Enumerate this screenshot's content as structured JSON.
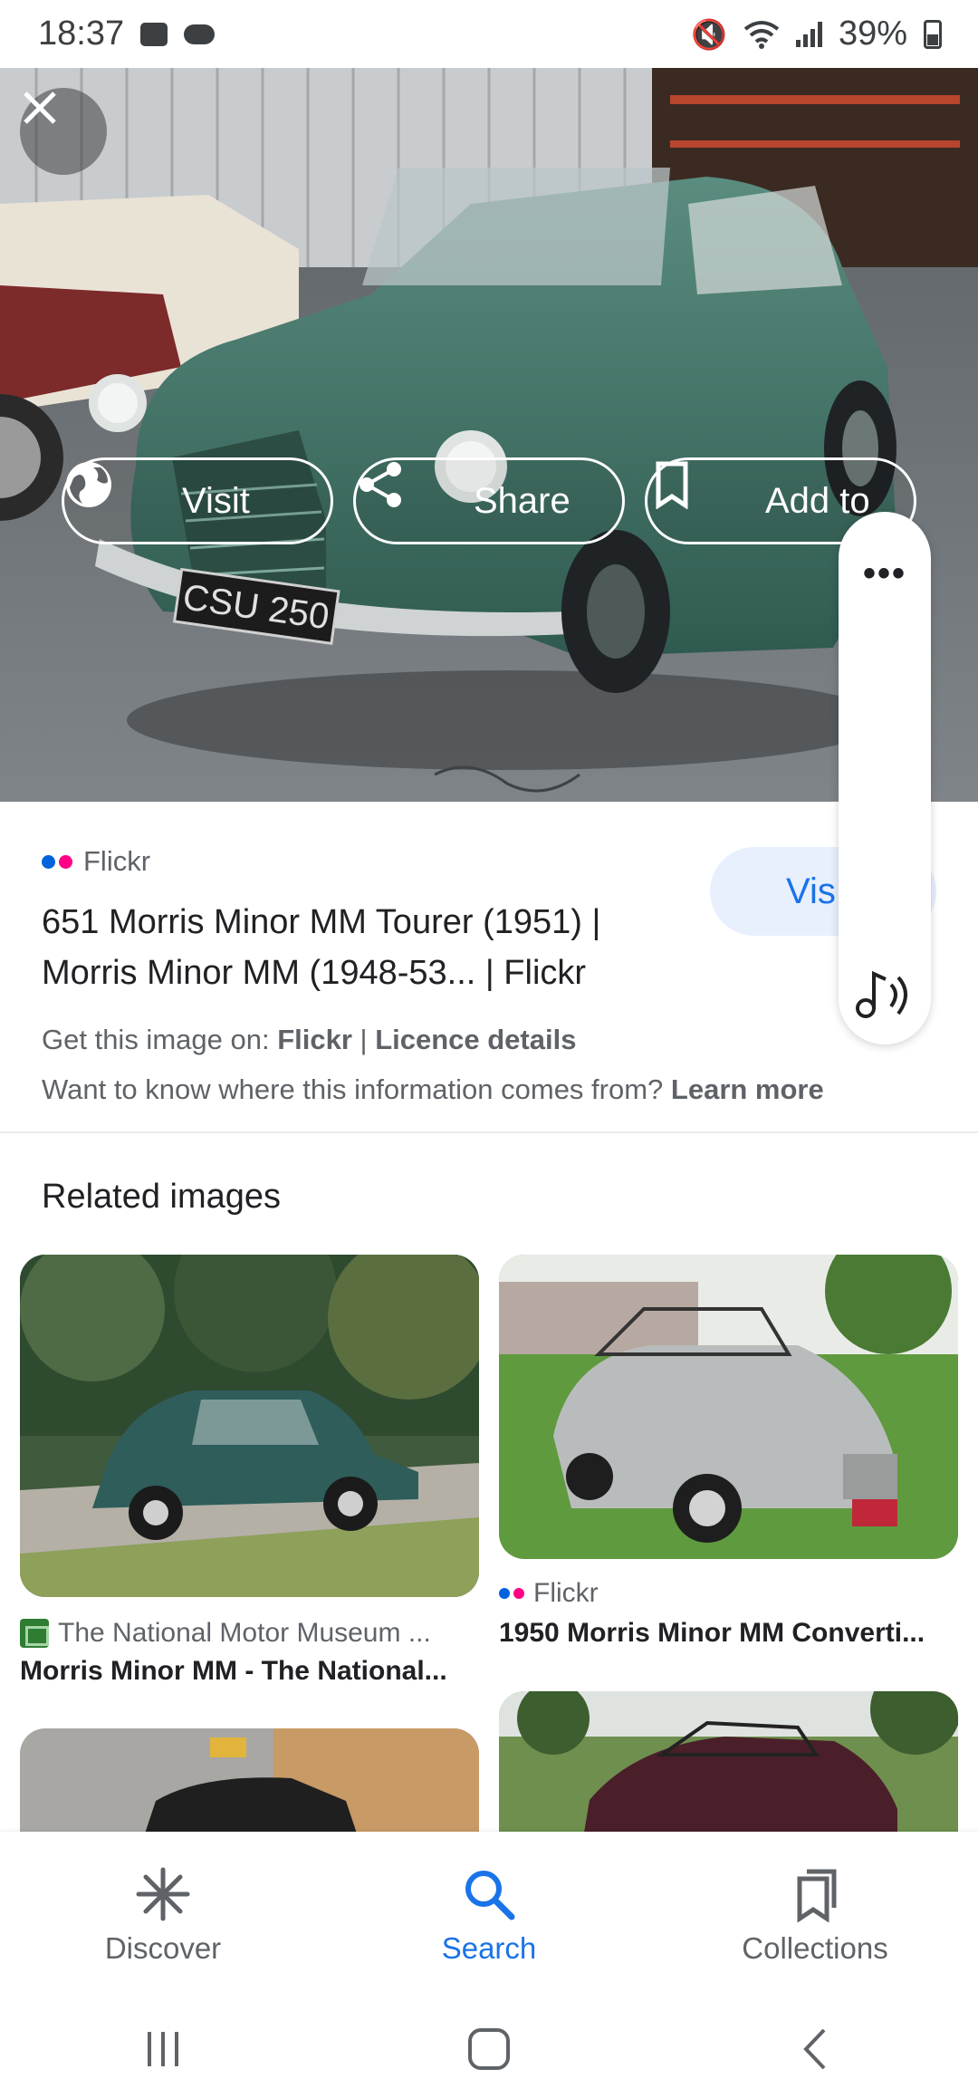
{
  "status_bar": {
    "time": "18:37",
    "battery": "39%"
  },
  "hero": {
    "actions": [
      {
        "label": "Visit",
        "icon": "globe-icon"
      },
      {
        "label": "Share",
        "icon": "share-icon"
      },
      {
        "label": "Add to",
        "icon": "bookmark-icon"
      }
    ]
  },
  "result": {
    "source": "Flickr",
    "title": "651 Morris Minor MM Tourer (1951) | Morris Minor MM (1948-53... | Flickr",
    "visit_label": "Vis",
    "get_image_prefix": "Get this image on: ",
    "get_image_source": "Flickr",
    "separator": " | ",
    "licence_details": "Licence details",
    "want_to_know": "Want to know where this information comes from? ",
    "learn_more": "Learn more"
  },
  "related": {
    "heading": "Related images",
    "items": [
      {
        "source": "The National Motor Museum ...",
        "caption": "Morris Minor MM - The National..."
      },
      {
        "source": "Flickr",
        "caption": "1950 Morris Minor MM Converti..."
      }
    ]
  },
  "bottom_nav": [
    {
      "label": "Discover",
      "icon": "asterisk-icon",
      "active": false
    },
    {
      "label": "Search",
      "icon": "search-icon",
      "active": true
    },
    {
      "label": "Collections",
      "icon": "collections-icon",
      "active": false
    }
  ],
  "colors": {
    "accent": "#1a73e8",
    "flickr_blue": "#0063dc",
    "flickr_pink": "#ff0084",
    "car_green": "#3d6e62"
  }
}
